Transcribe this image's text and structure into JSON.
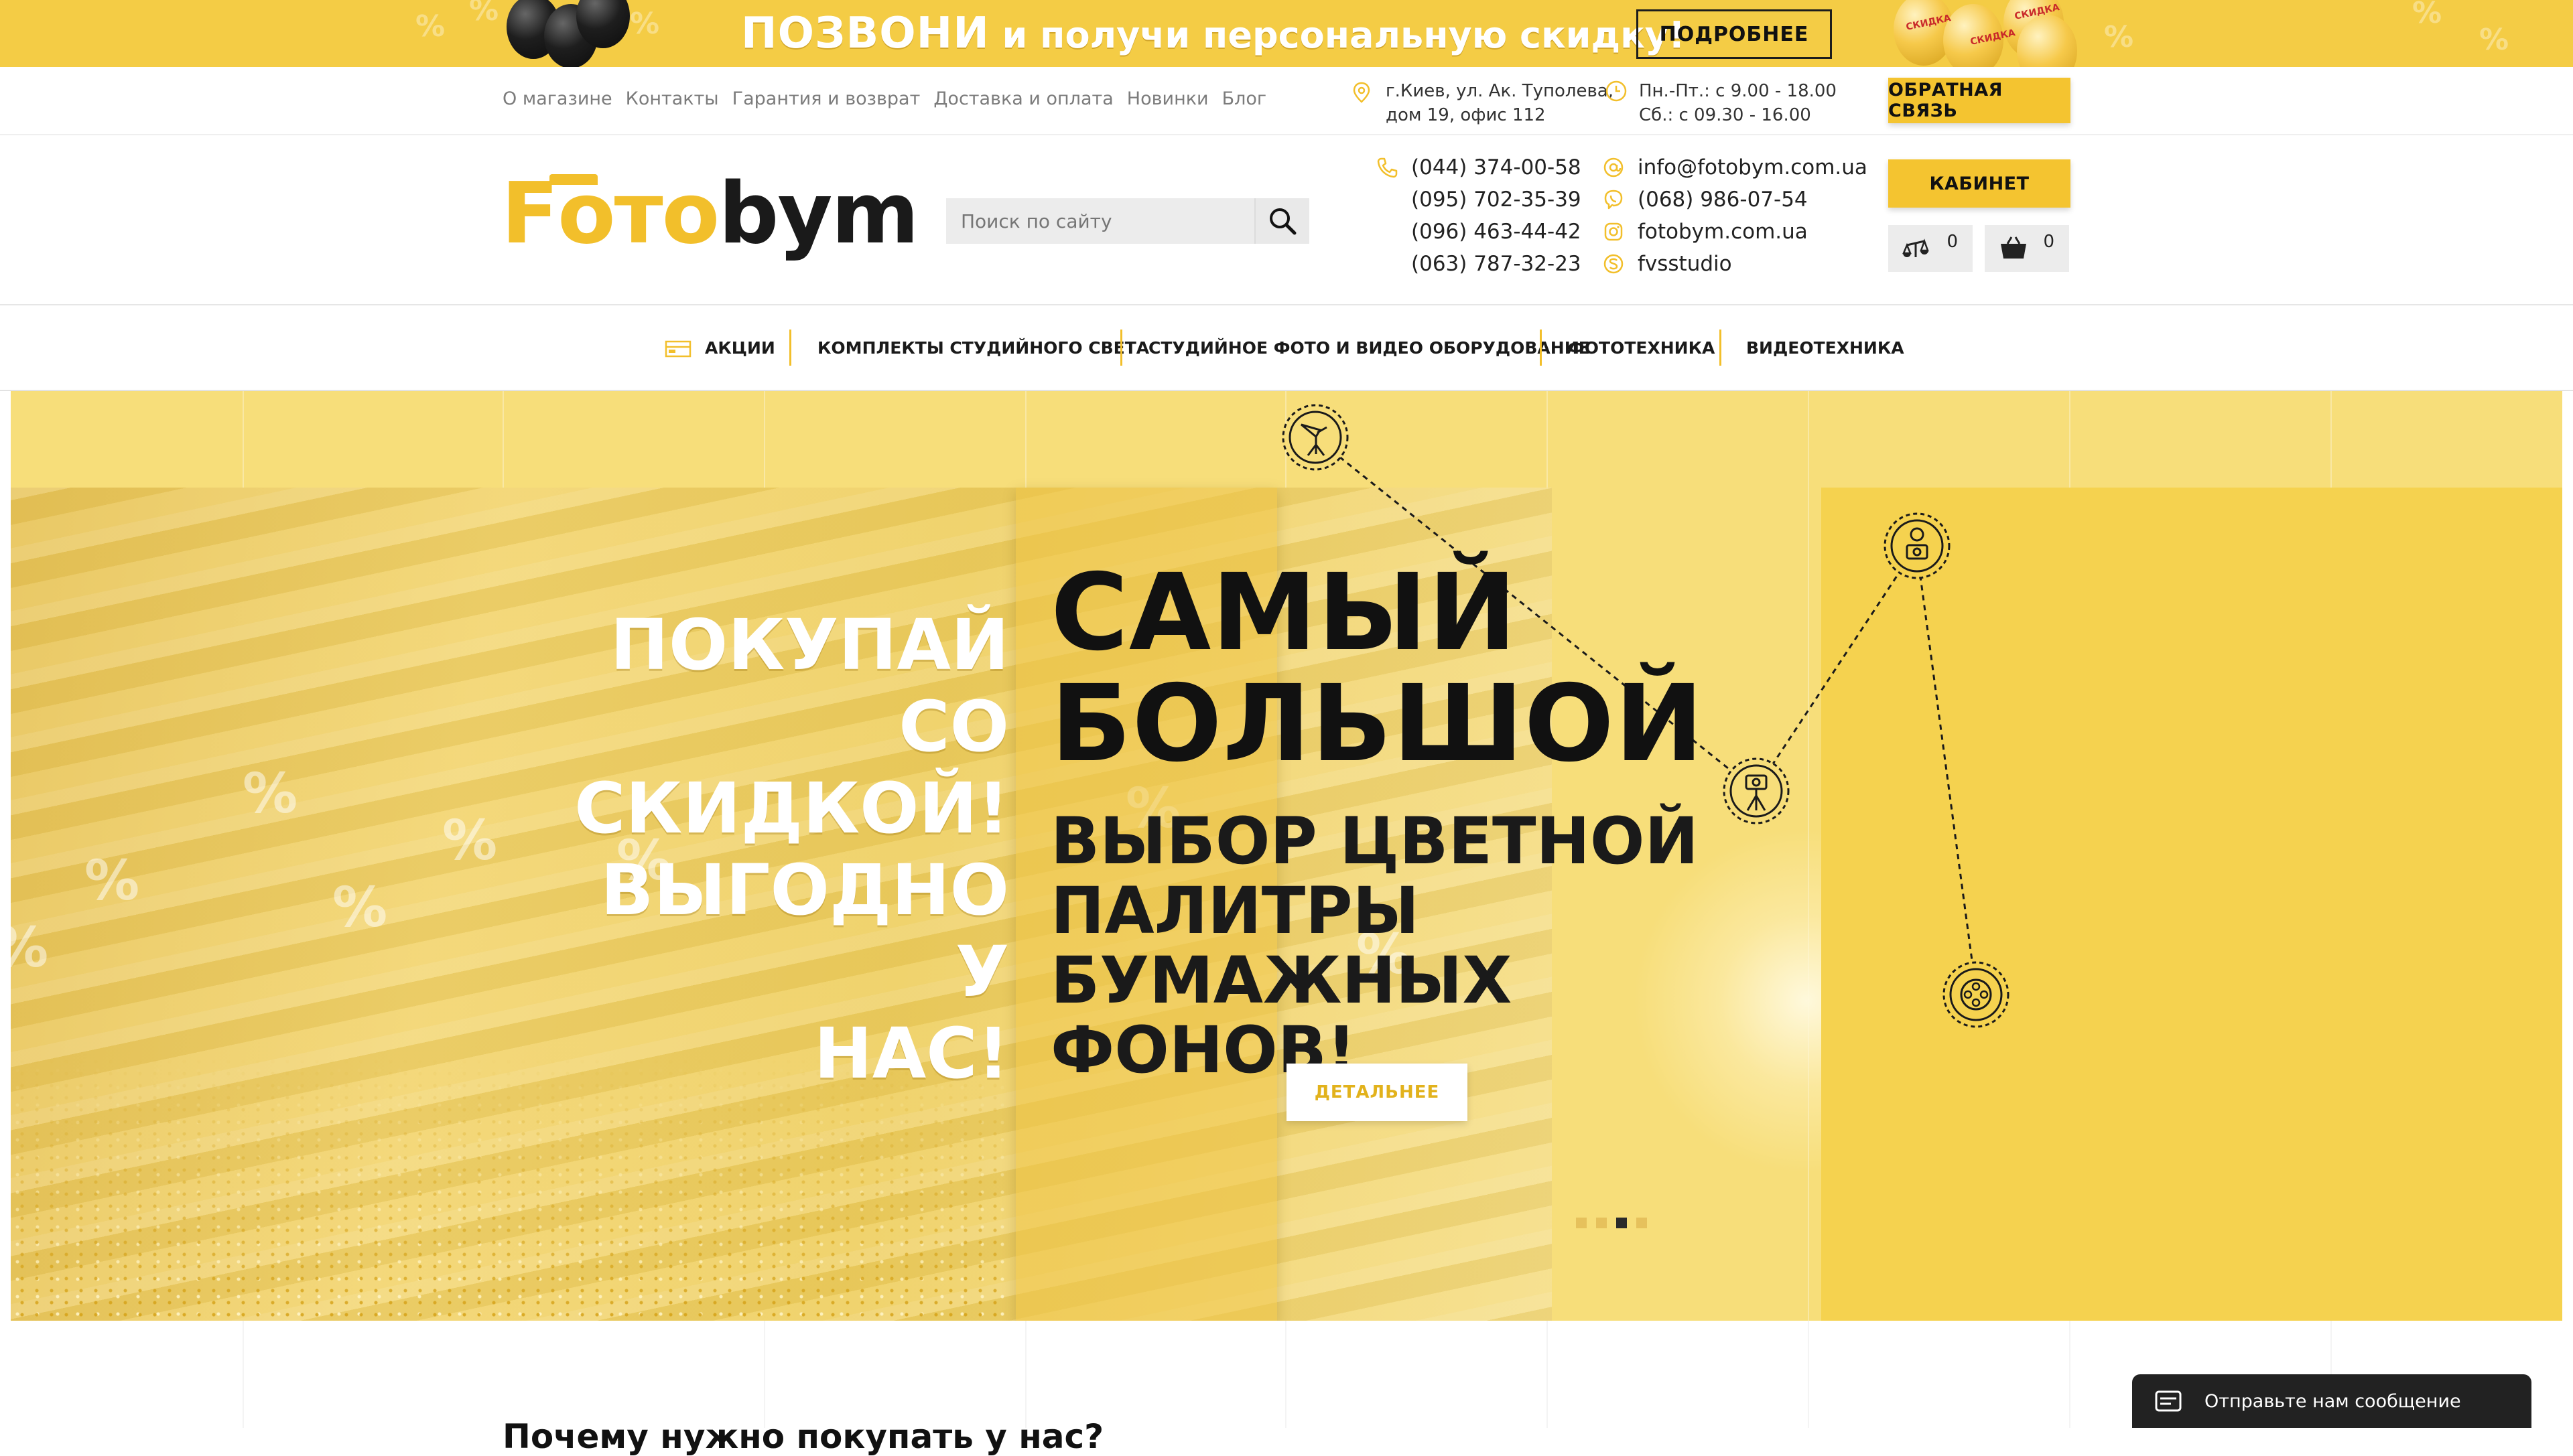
{
  "promo": {
    "headline_big": "ПОЗВОНИ",
    "headline_small": " и получи персональную скидку!",
    "button": "ПОДРОБНЕЕ",
    "balloon_tag": "СКИДКА",
    "percent_glyph": "%",
    "colors": {
      "background": "#f4cc45",
      "text": "#ffffff"
    }
  },
  "topnav": [
    "О магазине",
    "Контакты",
    "Гарантия и возврат",
    "Доставка и оплата",
    "Новинки",
    "Блог"
  ],
  "address": {
    "line1": "г.Киев, ул. Ак. Туполева,",
    "line2": "дом 19, офис 112",
    "icon": "location-pin-icon"
  },
  "hours": {
    "line1": "Пн.-Пт.: с 9.00 - 18.00",
    "line2": "Сб.: с 09.30 - 16.00",
    "icon": "clock-icon"
  },
  "feedback_button": "ОБРАТНАЯ СВЯЗЬ",
  "logo": {
    "part1": "Fото",
    "part2": "bym",
    "colors": {
      "accent": "#f2bf2b",
      "dark": "#1a1a1a"
    }
  },
  "search": {
    "placeholder": "Поиск по сайту",
    "value": ""
  },
  "phones": [
    "(044) 374-00-58",
    "(095) 702-35-39",
    "(096) 463-44-42",
    "(063) 787-32-23"
  ],
  "contacts": [
    {
      "text": "info@fotobym.com.ua",
      "icon": "email-icon"
    },
    {
      "text": "(068) 986-07-54",
      "icon": "viber-icon"
    },
    {
      "text": "fotobym.com.ua",
      "icon": "instagram-icon"
    },
    {
      "text": "fvsstudio",
      "icon": "skype-icon"
    }
  ],
  "cabinet_button": "КАБИНЕТ",
  "compare": {
    "count": "0",
    "icon": "compare-scales-icon"
  },
  "cart": {
    "count": "0",
    "icon": "cart-basket-icon"
  },
  "categories": [
    {
      "label": "АКЦИИ",
      "icon": "sale-tag-icon"
    },
    {
      "label": "КОМПЛЕКТЫ СТУДИЙНОГО СВЕТА"
    },
    {
      "label": "СТУДИЙНОЕ ФОТО И ВИДЕО ОБОРУДОВАНИЕ"
    },
    {
      "label": "ФОТОТЕХНИКА"
    },
    {
      "label": "ВИДЕОТЕХНИКА"
    }
  ],
  "hero": {
    "left_slogan": [
      "ПОКУПАЙ СО",
      "СКИДКОЙ!",
      "ВЫГОДНО У",
      "НАС!"
    ],
    "title": [
      "САМЫЙ",
      "БОЛЬШОЙ"
    ],
    "subtitle": [
      "ВЫБОР ЦВЕТНОЙ",
      "ПАЛИТРЫ БУМАЖНЫХ",
      "ФОНОВ!"
    ],
    "button": "ДЕТАЛЬНЕЕ",
    "route_icons": [
      "studio-light-stand-icon",
      "camera-operator-icon",
      "tripod-camera-icon",
      "film-reel-icon"
    ],
    "slides_count": 4,
    "active_slide": 3,
    "colors": {
      "background": "#f7de7a",
      "panel": "#f5d24f",
      "title": "#111111",
      "button_text": "#e2b21c"
    }
  },
  "section_title": "Почему нужно покупать у нас?",
  "chat": {
    "label": "Отправьте нам сообщение",
    "icon": "message-icon"
  }
}
